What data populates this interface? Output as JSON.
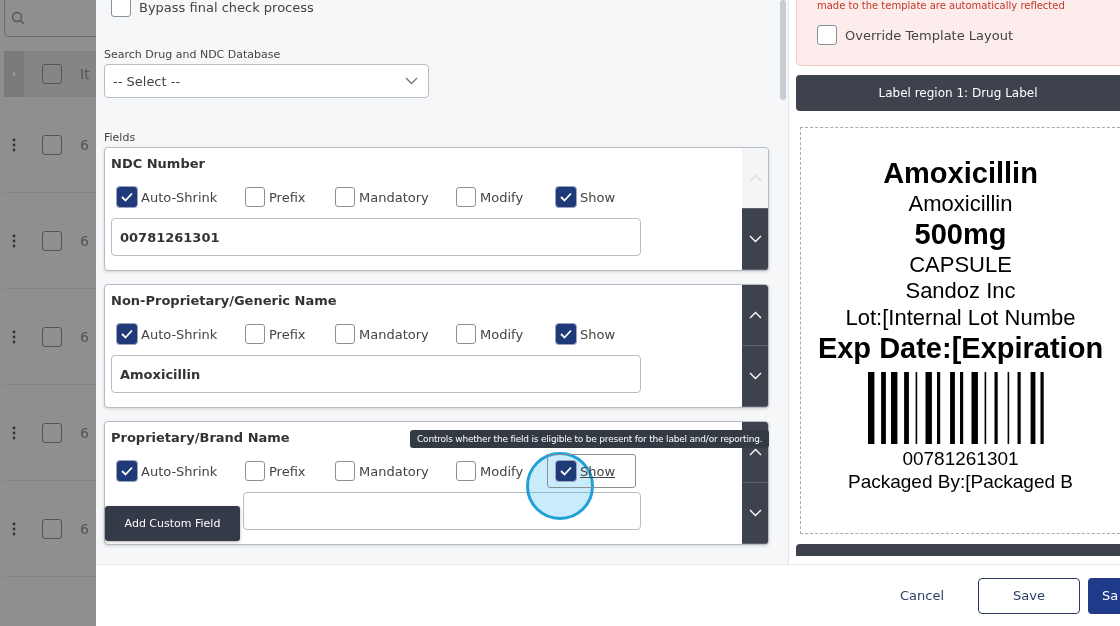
{
  "backdrop": {
    "header": {
      "label": "It",
      "checked": false
    },
    "rows": [
      {
        "id": "6",
        "checked": false
      },
      {
        "id": "6",
        "checked": false
      },
      {
        "id": "6",
        "checked": false
      },
      {
        "id": "6",
        "checked": false
      },
      {
        "id": "6",
        "checked": false
      }
    ]
  },
  "form": {
    "bypass": {
      "label": "Bypass final check process",
      "checked": false
    },
    "drug_search": {
      "label": "Search Drug and NDC Database",
      "placeholder": "-- Select --"
    },
    "fields_label": "Fields",
    "fields": [
      {
        "title": "NDC Number",
        "value": "00781261301",
        "move_up_disabled": true,
        "options": [
          {
            "label": "Auto-Shrink",
            "checked": true,
            "focused": false
          },
          {
            "label": "Prefix",
            "checked": false,
            "focused": false
          },
          {
            "label": "Mandatory",
            "checked": false,
            "focused": false
          },
          {
            "label": "Modify",
            "checked": false,
            "focused": false
          },
          {
            "label": "Show",
            "checked": true,
            "focused": false
          }
        ]
      },
      {
        "title": "Non-Proprietary/Generic Name",
        "value": "Amoxicillin",
        "move_up_disabled": false,
        "options": [
          {
            "label": "Auto-Shrink",
            "checked": true,
            "focused": false
          },
          {
            "label": "Prefix",
            "checked": false,
            "focused": false
          },
          {
            "label": "Mandatory",
            "checked": false,
            "focused": false
          },
          {
            "label": "Modify",
            "checked": false,
            "focused": false
          },
          {
            "label": "Show",
            "checked": true,
            "focused": false
          }
        ]
      },
      {
        "title": "Proprietary/Brand Name",
        "move_up_disabled": false,
        "options": [
          {
            "label": "Auto-Shrink",
            "checked": true,
            "focused": false
          },
          {
            "label": "Prefix",
            "checked": false,
            "focused": false
          },
          {
            "label": "Mandatory",
            "checked": false,
            "focused": false
          },
          {
            "label": "Modify",
            "checked": false,
            "focused": false
          },
          {
            "label": "Show",
            "checked": true,
            "focused": true
          }
        ]
      }
    ],
    "tooltip": "Controls whether the field is eligible to be present for the label and/or reporting.",
    "add_button": "Add Custom Field"
  },
  "template": {
    "notice": "made to the template are automatically reflected",
    "override": {
      "label": "Override Template Layout",
      "checked": false
    },
    "region_title": "Label region 1: Drug Label",
    "label_lines": [
      {
        "kind": "heading",
        "text": "Amoxicillin"
      },
      {
        "kind": "text",
        "text": "Amoxicillin"
      },
      {
        "kind": "heading",
        "text": "500mg"
      },
      {
        "kind": "text",
        "text": "CAPSULE"
      },
      {
        "kind": "text",
        "text": "Sandoz Inc"
      },
      {
        "kind": "text",
        "text": "Lot:[Internal Lot Numbe"
      },
      {
        "kind": "heading",
        "text": "Exp Date:[Expiration"
      },
      {
        "kind": "barcode"
      },
      {
        "kind": "small",
        "text": "00781261301"
      },
      {
        "kind": "small",
        "text": "Packaged By:[Packaged B"
      }
    ]
  },
  "footer": {
    "buttons": [
      {
        "kind": "link",
        "label": "Cancel"
      },
      {
        "kind": "outline",
        "label": "Save"
      },
      {
        "kind": "primary",
        "label": "Sa"
      }
    ]
  }
}
